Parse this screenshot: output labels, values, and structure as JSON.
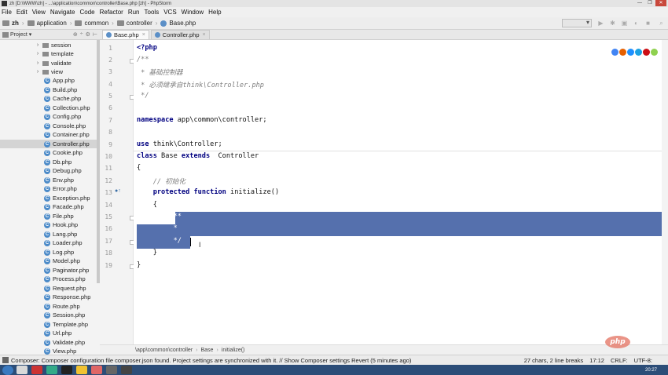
{
  "window": {
    "title": "zh [D:\\WWW\\zh] - ...\\application\\common\\controller\\Base.php [zh] - PhpStorm",
    "buttons": [
      "—",
      "❐",
      "✕"
    ]
  },
  "menu": [
    "File",
    "Edit",
    "View",
    "Navigate",
    "Code",
    "Refactor",
    "Run",
    "Tools",
    "VCS",
    "Window",
    "Help"
  ],
  "navbar": {
    "crumbs": [
      "zh",
      "application",
      "common",
      "controller",
      "Base.php"
    ]
  },
  "project_panel": {
    "label": "Project",
    "tools": [
      "⊕",
      "÷",
      "⚙",
      "⊢"
    ]
  },
  "tabs": [
    {
      "label": "Base.php",
      "active": true
    },
    {
      "label": "Controller.php",
      "active": false
    }
  ],
  "tree": {
    "folders": [
      "session",
      "template",
      "validate",
      "view"
    ],
    "files": [
      "App.php",
      "Build.php",
      "Cache.php",
      "Collection.php",
      "Config.php",
      "Console.php",
      "Container.php",
      "Controller.php",
      "Cookie.php",
      "Db.php",
      "Debug.php",
      "Env.php",
      "Error.php",
      "Exception.php",
      "Facade.php",
      "File.php",
      "Hook.php",
      "Lang.php",
      "Loader.php",
      "Log.php",
      "Model.php",
      "Paginator.php",
      "Process.php",
      "Request.php",
      "Response.php",
      "Route.php",
      "Session.php",
      "Template.php",
      "Url.php",
      "Validate.php",
      "View.php"
    ],
    "selected": "Controller.php"
  },
  "editor": {
    "line_numbers": [
      "1",
      "2",
      "3",
      "4",
      "5",
      "6",
      "7",
      "8",
      "9",
      "10",
      "11",
      "12",
      "13",
      "14",
      "15",
      "16",
      "17",
      "18",
      "19"
    ],
    "l1": "<?php",
    "l2": "/**",
    "l3": " * 基础控制器",
    "l4": " * 必须继承自think\\Controller.php",
    "l5": " */",
    "l7_kw": "namespace",
    "l7_rest": " app\\common\\controller;",
    "l9_kw": "use",
    "l9_rest": " think\\Controller;",
    "l10_kw1": "class",
    "l10_mid": " Base ",
    "l10_kw2": "extends",
    "l10_rest": "  Controller",
    "l11": "{",
    "l12": "    // 初始化",
    "l13_kw1": "protected",
    "l13_kw2": "function",
    "l13_rest": " initialize()",
    "l14": "    {",
    "l15": "        /**",
    "l16": "         *",
    "l17": "         */",
    "l18": "    }",
    "l19": "}"
  },
  "editor_breadcrumb": [
    "\\app\\common\\controller",
    "Base",
    "initialize()"
  ],
  "status": {
    "message": "Composer: Composer configuration file composer.json found. Project settings are synchronized with it. // Show Composer settings Revert (5 minutes ago)",
    "chars": "27 chars, 2 line breaks",
    "position": "17:12",
    "line_sep": "CRLF:",
    "encoding": "UTF-8:"
  },
  "watermark": "php",
  "taskbar": {
    "clock": "20:27"
  },
  "colors": {
    "selection": "#5570ad",
    "keyword": "#000080",
    "comment": "#808080"
  }
}
